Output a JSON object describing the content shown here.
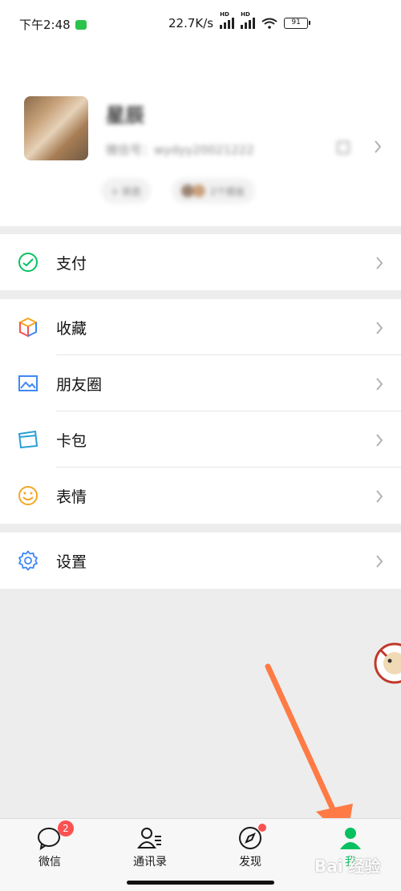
{
  "status_bar": {
    "time": "下午2:48",
    "speed": "22.7K/s",
    "battery": "91",
    "hd1": "HD",
    "hd2": "HD"
  },
  "profile": {
    "nickname": "星辰",
    "wechat_id": "微信号：wydyy20021222",
    "status_chip": "+ 状态",
    "friends_chip": "2个朋友"
  },
  "menu": {
    "pay": "支付",
    "favorites": "收藏",
    "moments": "朋友圈",
    "cards": "卡包",
    "stickers": "表情",
    "settings": "设置"
  },
  "tabbar": {
    "chats": "微信",
    "chats_badge": "2",
    "contacts": "通讯录",
    "discover": "发现",
    "me": "我"
  },
  "watermark": "Bai 经验",
  "colors": {
    "accent": "#07c160",
    "badge": "#fa5151",
    "arrow": "#ff7a45"
  }
}
